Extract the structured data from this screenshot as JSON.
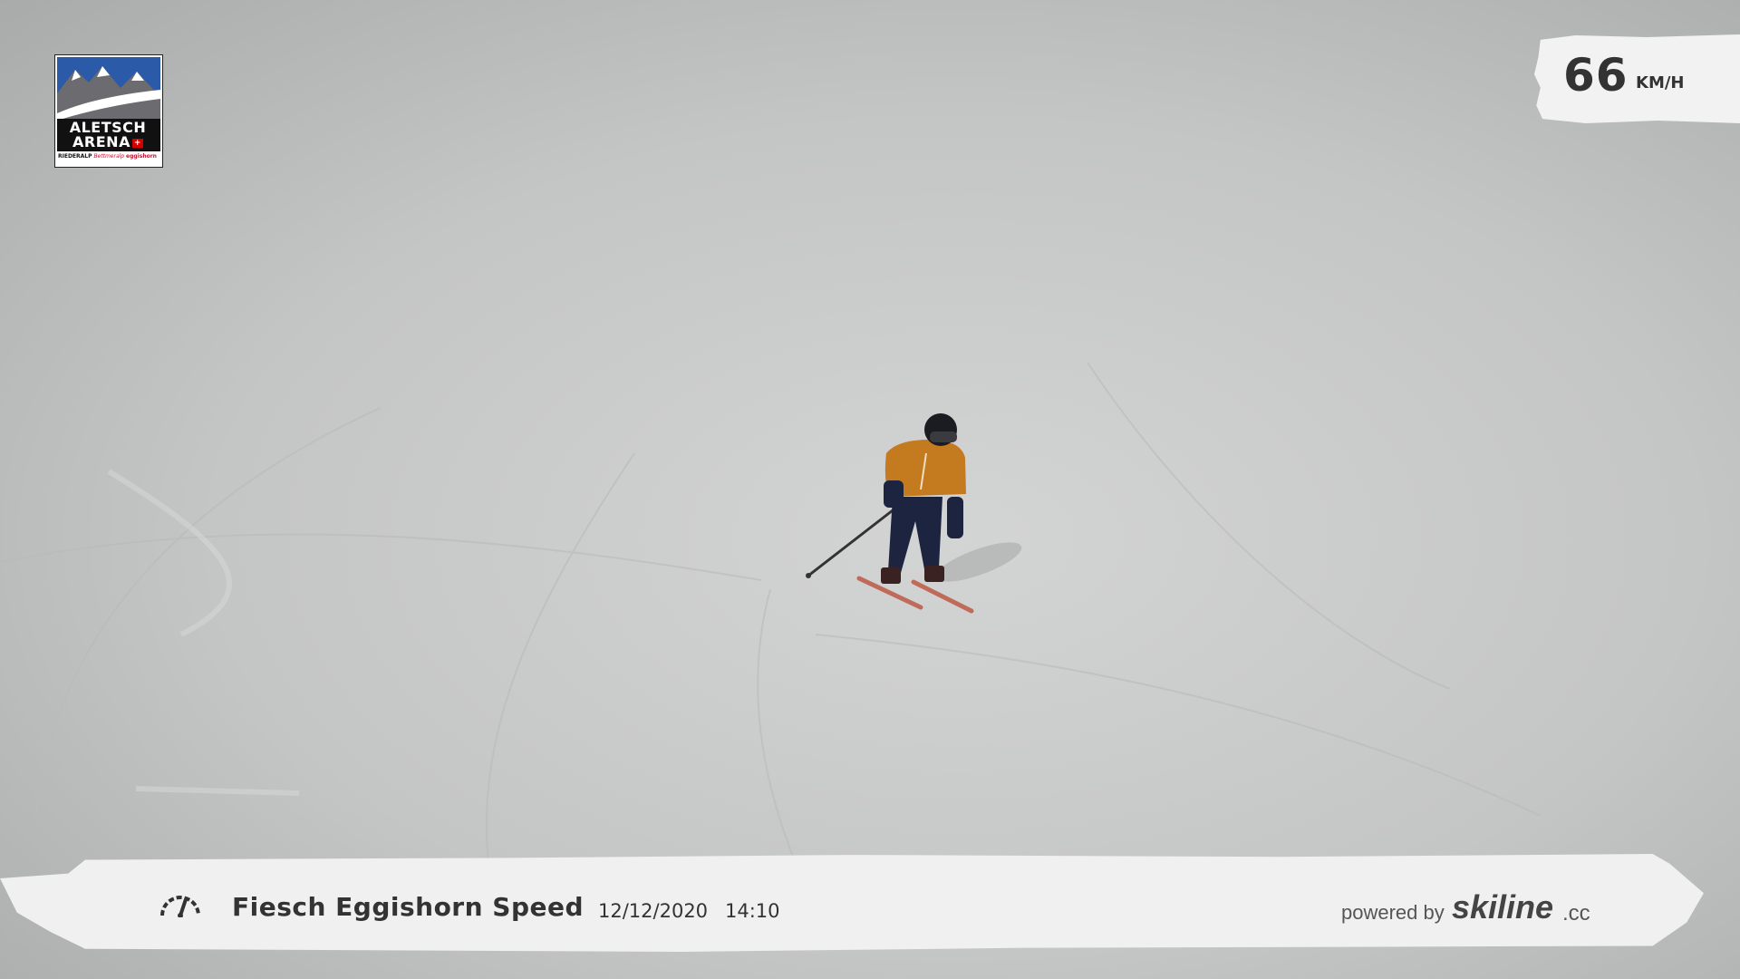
{
  "logo": {
    "line1": "ALETSCH",
    "line2": "ARENA",
    "sub_left": "RIEDERALP",
    "sub_mid": "Bettmeralp",
    "sub_right": "eggishorn"
  },
  "speed": {
    "value": "66",
    "unit": "KM/H"
  },
  "footer": {
    "title": "Fiesch Eggishorn Speed",
    "date": "12/12/2020",
    "time": "14:10",
    "powered_by": "powered by",
    "brand": "skiline",
    "brand_tld": ".cc"
  },
  "icons": {
    "speed": "speedometer-icon",
    "logo_mountains": "mountain-icon",
    "flag": "swiss-flag-icon"
  },
  "colors": {
    "jacket": "#c47a1e",
    "pants": "#1c2440",
    "skis": "#c06a5a",
    "snow": "#c9caca"
  }
}
